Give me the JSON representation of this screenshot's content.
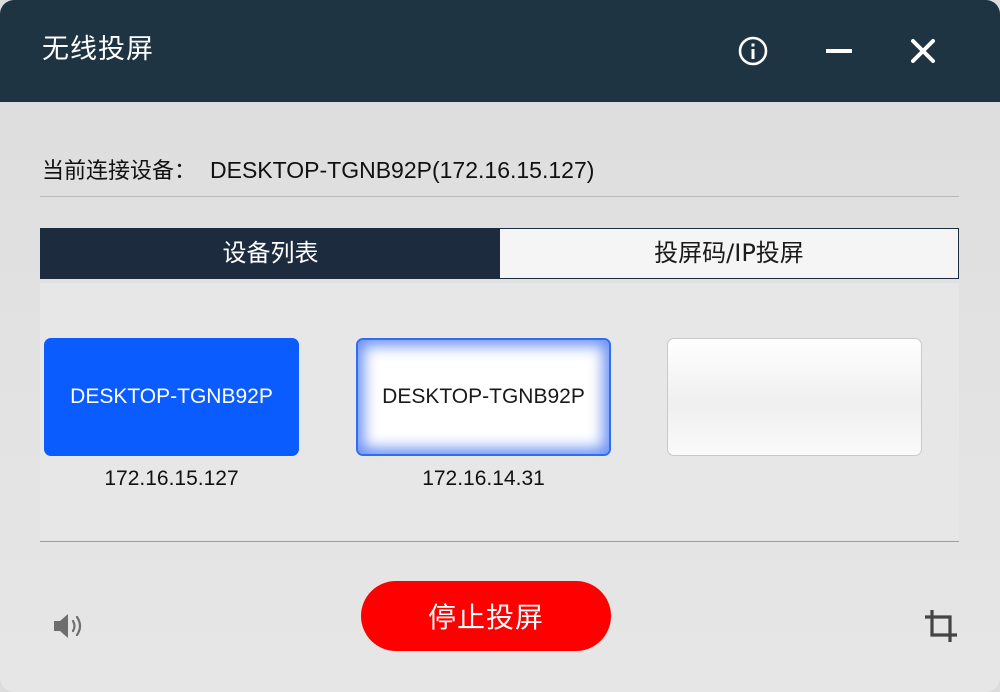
{
  "window": {
    "title": "无线投屏",
    "icons": [
      "info-icon",
      "minimize-icon",
      "close-icon"
    ]
  },
  "connection": {
    "label": "当前连接设备：",
    "value": "DESKTOP-TGNB92P(172.16.15.127)"
  },
  "tabs": [
    {
      "label": "设备列表",
      "active": true
    },
    {
      "label": "投屏码/IP投屏",
      "active": false
    }
  ],
  "devices": [
    {
      "name": "DESKTOP-TGNB92P",
      "ip": "172.16.15.127",
      "state": "connected"
    },
    {
      "name": "DESKTOP-TGNB92P",
      "ip": "172.16.14.31",
      "state": "hover"
    },
    {
      "name": "",
      "ip": "",
      "state": "empty"
    }
  ],
  "actions": {
    "stop_label": "停止投屏"
  },
  "footer_icons": [
    "speaker-icon",
    "crop-icon"
  ],
  "colors": {
    "titlebar": "#1e3442",
    "active_tab": "#1d2b3f",
    "connected_device": "#0b5cff",
    "stop_button": "#ff0000"
  }
}
